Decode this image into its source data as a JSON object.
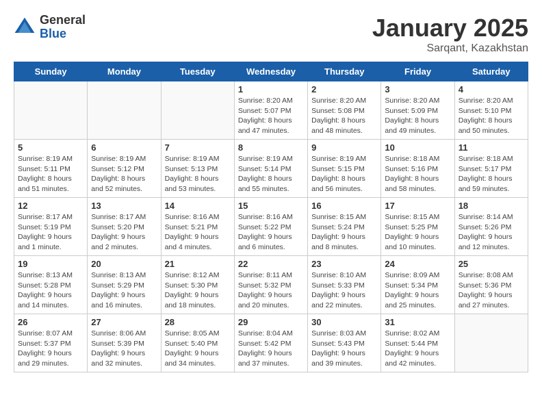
{
  "logo": {
    "general": "General",
    "blue": "Blue"
  },
  "title": "January 2025",
  "subtitle": "Sarqant, Kazakhstan",
  "weekdays": [
    "Sunday",
    "Monday",
    "Tuesday",
    "Wednesday",
    "Thursday",
    "Friday",
    "Saturday"
  ],
  "weeks": [
    [
      {
        "num": "",
        "info": ""
      },
      {
        "num": "",
        "info": ""
      },
      {
        "num": "",
        "info": ""
      },
      {
        "num": "1",
        "info": "Sunrise: 8:20 AM\nSunset: 5:07 PM\nDaylight: 8 hours and 47 minutes."
      },
      {
        "num": "2",
        "info": "Sunrise: 8:20 AM\nSunset: 5:08 PM\nDaylight: 8 hours and 48 minutes."
      },
      {
        "num": "3",
        "info": "Sunrise: 8:20 AM\nSunset: 5:09 PM\nDaylight: 8 hours and 49 minutes."
      },
      {
        "num": "4",
        "info": "Sunrise: 8:20 AM\nSunset: 5:10 PM\nDaylight: 8 hours and 50 minutes."
      }
    ],
    [
      {
        "num": "5",
        "info": "Sunrise: 8:19 AM\nSunset: 5:11 PM\nDaylight: 8 hours and 51 minutes."
      },
      {
        "num": "6",
        "info": "Sunrise: 8:19 AM\nSunset: 5:12 PM\nDaylight: 8 hours and 52 minutes."
      },
      {
        "num": "7",
        "info": "Sunrise: 8:19 AM\nSunset: 5:13 PM\nDaylight: 8 hours and 53 minutes."
      },
      {
        "num": "8",
        "info": "Sunrise: 8:19 AM\nSunset: 5:14 PM\nDaylight: 8 hours and 55 minutes."
      },
      {
        "num": "9",
        "info": "Sunrise: 8:19 AM\nSunset: 5:15 PM\nDaylight: 8 hours and 56 minutes."
      },
      {
        "num": "10",
        "info": "Sunrise: 8:18 AM\nSunset: 5:16 PM\nDaylight: 8 hours and 58 minutes."
      },
      {
        "num": "11",
        "info": "Sunrise: 8:18 AM\nSunset: 5:17 PM\nDaylight: 8 hours and 59 minutes."
      }
    ],
    [
      {
        "num": "12",
        "info": "Sunrise: 8:17 AM\nSunset: 5:19 PM\nDaylight: 9 hours and 1 minute."
      },
      {
        "num": "13",
        "info": "Sunrise: 8:17 AM\nSunset: 5:20 PM\nDaylight: 9 hours and 2 minutes."
      },
      {
        "num": "14",
        "info": "Sunrise: 8:16 AM\nSunset: 5:21 PM\nDaylight: 9 hours and 4 minutes."
      },
      {
        "num": "15",
        "info": "Sunrise: 8:16 AM\nSunset: 5:22 PM\nDaylight: 9 hours and 6 minutes."
      },
      {
        "num": "16",
        "info": "Sunrise: 8:15 AM\nSunset: 5:24 PM\nDaylight: 9 hours and 8 minutes."
      },
      {
        "num": "17",
        "info": "Sunrise: 8:15 AM\nSunset: 5:25 PM\nDaylight: 9 hours and 10 minutes."
      },
      {
        "num": "18",
        "info": "Sunrise: 8:14 AM\nSunset: 5:26 PM\nDaylight: 9 hours and 12 minutes."
      }
    ],
    [
      {
        "num": "19",
        "info": "Sunrise: 8:13 AM\nSunset: 5:28 PM\nDaylight: 9 hours and 14 minutes."
      },
      {
        "num": "20",
        "info": "Sunrise: 8:13 AM\nSunset: 5:29 PM\nDaylight: 9 hours and 16 minutes."
      },
      {
        "num": "21",
        "info": "Sunrise: 8:12 AM\nSunset: 5:30 PM\nDaylight: 9 hours and 18 minutes."
      },
      {
        "num": "22",
        "info": "Sunrise: 8:11 AM\nSunset: 5:32 PM\nDaylight: 9 hours and 20 minutes."
      },
      {
        "num": "23",
        "info": "Sunrise: 8:10 AM\nSunset: 5:33 PM\nDaylight: 9 hours and 22 minutes."
      },
      {
        "num": "24",
        "info": "Sunrise: 8:09 AM\nSunset: 5:34 PM\nDaylight: 9 hours and 25 minutes."
      },
      {
        "num": "25",
        "info": "Sunrise: 8:08 AM\nSunset: 5:36 PM\nDaylight: 9 hours and 27 minutes."
      }
    ],
    [
      {
        "num": "26",
        "info": "Sunrise: 8:07 AM\nSunset: 5:37 PM\nDaylight: 9 hours and 29 minutes."
      },
      {
        "num": "27",
        "info": "Sunrise: 8:06 AM\nSunset: 5:39 PM\nDaylight: 9 hours and 32 minutes."
      },
      {
        "num": "28",
        "info": "Sunrise: 8:05 AM\nSunset: 5:40 PM\nDaylight: 9 hours and 34 minutes."
      },
      {
        "num": "29",
        "info": "Sunrise: 8:04 AM\nSunset: 5:42 PM\nDaylight: 9 hours and 37 minutes."
      },
      {
        "num": "30",
        "info": "Sunrise: 8:03 AM\nSunset: 5:43 PM\nDaylight: 9 hours and 39 minutes."
      },
      {
        "num": "31",
        "info": "Sunrise: 8:02 AM\nSunset: 5:44 PM\nDaylight: 9 hours and 42 minutes."
      },
      {
        "num": "",
        "info": ""
      }
    ]
  ]
}
